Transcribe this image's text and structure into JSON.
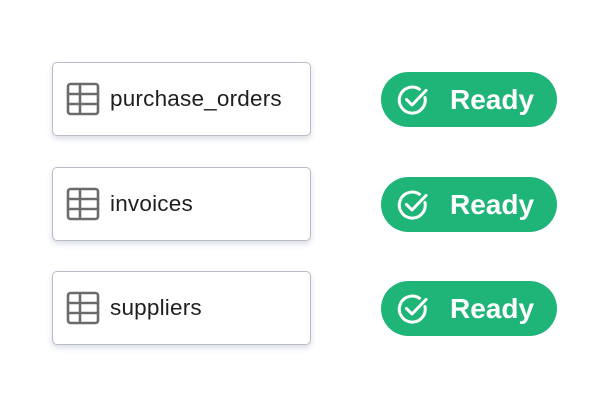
{
  "colors": {
    "ready_green": "#1fb578",
    "card_border": "#b9bcc9",
    "icon_gray": "#6b6b6b",
    "text_dark": "#1f1f1f"
  },
  "tables": [
    {
      "name": "purchase_orders",
      "icon": "table-grid-icon",
      "status": "Ready",
      "status_icon": "check-circle-icon"
    },
    {
      "name": "invoices",
      "icon": "table-grid-icon",
      "status": "Ready",
      "status_icon": "check-circle-icon"
    },
    {
      "name": "suppliers",
      "icon": "table-grid-icon",
      "status": "Ready",
      "status_icon": "check-circle-icon"
    }
  ]
}
